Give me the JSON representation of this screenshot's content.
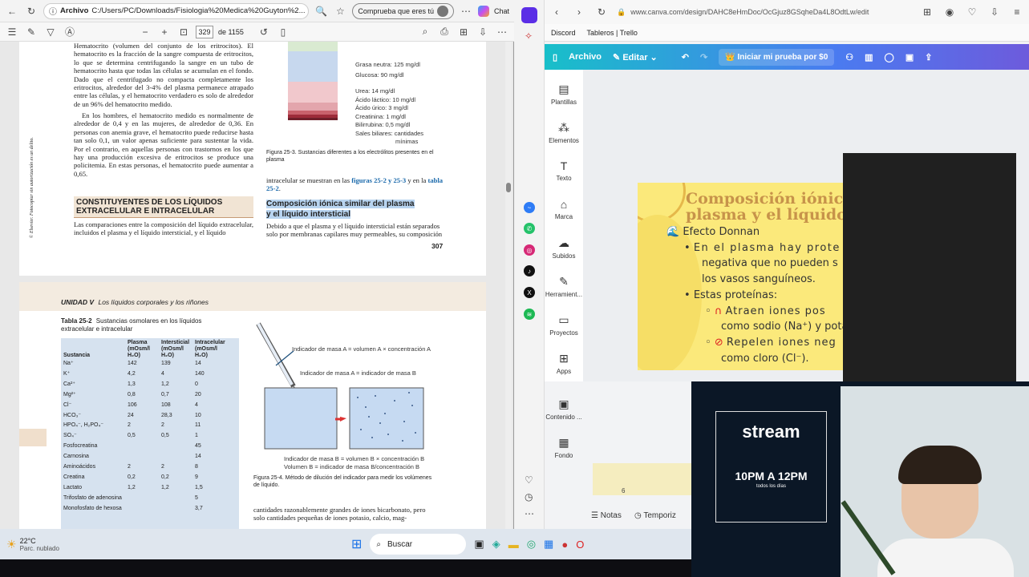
{
  "left_browser": {
    "tab_label": "Archivo",
    "url": "C:/Users/PC/Downloads/Fisiologia%20Medica%20Guyton%2...",
    "profile_pill": "Comprueba que eres tú",
    "chat_label": "Chat",
    "page_number": "329",
    "page_total": "de 1155"
  },
  "pdf": {
    "p1_col1_top": "Hematocrito (volumen del conjunto de los eritrocitos). El hematocrito es la fracción de la sangre compuesta de eritrocitos, lo que se determina centrifugando la sangre en un tubo de hematocrito hasta que todas las células se acumulan en el fondo. Dado que el centrifugado no compacta completamente los eritrocitos, alrededor del 3-4% del plasma permanece atrapado entre las células, y el hematocrito verdadero es solo de alrededor de un 96% del hematocrito medido.",
    "p1_col1_mid": "En los hombres, el hematocrito medido es normalmente de alrededor de 0,4 y en las mujeres, de alrededor de 0,36. En personas con anemia grave, el hematocrito puede reducirse hasta tan solo 0,1, un valor apenas suficiente para sustentar la vida. Por el contrario, en aquellas personas con trastornos en los que hay una producción excesiva de eritrocitos se produce una policitemia. En estas personas, el hematocrito puede aumentar a 0,65.",
    "p1_sec_heading": "CONSTITUYENTES DE LOS LÍQUIDOS EXTRACELULAR E INTRACELULAR",
    "p1_col1_bottom": "Las comparaciones entre la composición del líquido extracelular, incluidos el plasma y el líquido intersticial, y el líquido",
    "copyright": "© Elsevier. Fotocopiar sin autorización es un delito.",
    "fig_labels": [
      "Grasa neutra: 125 mg/dl",
      "Glucosa: 90 mg/dl",
      "Urea: 14 mg/dl",
      "Ácido láctico: 10 mg/dl",
      "Ácido úrico: 3 mg/dl",
      "Creatinina: 1 mg/dl",
      "Bilirrubina: 0,5 mg/dl",
      "Sales biliares: cantidades",
      "mínimas"
    ],
    "fig253_caption": "Figura 25-3. Sustancias diferentes a los electrólitos presentes en el plasma",
    "p1_col2_a": "intracelular se muestran en las",
    "p1_col2_link1": "figuras 25-2 y 25-3",
    "p1_col2_b": "y en la",
    "p1_col2_link2": "tabla 25-2",
    "p1_col2_heading": "Composición iónica similar del plasma y el líquido intersticial",
    "p1_col2_body": "Debido a que el plasma y el líquido intersticial están separados solo por membranas capilares muy permeables, su composición",
    "page_num": "307",
    "unit_header_bold": "UNIDAD V",
    "unit_header_text": "Los líquidos corporales y los riñones",
    "table_title_bold": "Tabla 25-2",
    "table_title_rest": "Sustancias osmolares en los líquidos extracelular e intracelular",
    "table_headers": [
      "Sustancia",
      "Plasma (mOsm/l H₂O)",
      "Intersticial (mOsm/l H₂O)",
      "Intracelular (mOsm/l H₂O)"
    ],
    "table_rows": [
      [
        "Na⁺",
        "142",
        "139",
        "14"
      ],
      [
        "K⁺",
        "4,2",
        "4",
        "140"
      ],
      [
        "Ca²⁺",
        "1,3",
        "1,2",
        "0"
      ],
      [
        "Mg²⁺",
        "0,8",
        "0,7",
        "20"
      ],
      [
        "Cl⁻",
        "106",
        "108",
        "4"
      ],
      [
        "HCO₃⁻",
        "24",
        "28,3",
        "10"
      ],
      [
        "HPO₄⁻, H₂PO₄⁻",
        "2",
        "2",
        "11"
      ],
      [
        "SO₄⁻",
        "0,5",
        "0,5",
        "1"
      ],
      [
        "Fosfocreatina",
        "",
        "",
        "45"
      ],
      [
        "Carnosina",
        "",
        "",
        "14"
      ],
      [
        "Aminoácidos",
        "2",
        "2",
        "8"
      ],
      [
        "Creatina",
        "0,2",
        "0,2",
        "9"
      ],
      [
        "Lactato",
        "1,2",
        "1,2",
        "1,5"
      ],
      [
        "Trifosfato de adenosina",
        "",
        "",
        "5"
      ],
      [
        "Monofosfato de hexosa",
        "",
        "",
        "3,7"
      ]
    ],
    "fig254_l1": "Indicador de masa A = volumen A × concentración A",
    "fig254_l2": "Indicador de masa A = indicador de masa B",
    "fig254_l3": "Indicador de masa B = volumen B × concentración B",
    "fig254_l4": "Volumen B = indicador de masa B/concentración B",
    "fig254_caption": "Figura 25-4. Método de dilución del indicador para medir los volúmenes de líquido.",
    "p2_col2_bottom": "cantidades razonablemente grandes de iones bicarbonato, pero solo cantidades pequeñas de iones potasio, calcio, mag-"
  },
  "taskbar": {
    "temp": "22°C",
    "weather": "Parc. nublado",
    "search_label": "Buscar"
  },
  "right_browser": {
    "url": "www.canva.com/design/DAHC8eHmDoc/OcGjuz8GSqheDa4L8OdtLw/edit",
    "bookmarks": [
      "Discord",
      "Tableros | Trello"
    ]
  },
  "canva": {
    "archivo": "Archivo",
    "editar": "Editar",
    "trial_label": "Iniciar mi prueba por $0",
    "sidebar": [
      "Plantillas",
      "Elementos",
      "Texto",
      "Marca",
      "Subidos",
      "Herramient...",
      "Proyectos",
      "Apps",
      "Contenido ...",
      "Fondo"
    ],
    "notes": "Notas",
    "timer": "Temporiz",
    "page_thumb": "6",
    "slide_title_1": "Composición iónica",
    "slide_title_2": "plasma y el líquido",
    "slide_subtitle": "Efecto Donnan",
    "slide_b1_l1": "En el plasma hay prote",
    "slide_b1_l2": "negativa que no pueden s",
    "slide_b1_l3": "los vasos sanguíneos.",
    "slide_b2": "Estas proteínas:",
    "slide_b2a_l1": "Atraen iones pos",
    "slide_b2a_l2": "como sodio (Na⁺) y pota",
    "slide_b2b_l1": "Repelen iones neg",
    "slide_b2b_l2": "como cloro (Cl⁻)."
  },
  "stream": {
    "title": "stream",
    "time": "10PM A 12PM",
    "days": "todos los días"
  },
  "colors": {
    "canva_gradient_start": "#18bfc9",
    "canva_gradient_end": "#6d5bdc",
    "slide_bg": "#fbe97b",
    "slide_title": "#c7934a",
    "section_bg": "#f1e4d4",
    "table_bg": "#d6e2ef"
  }
}
